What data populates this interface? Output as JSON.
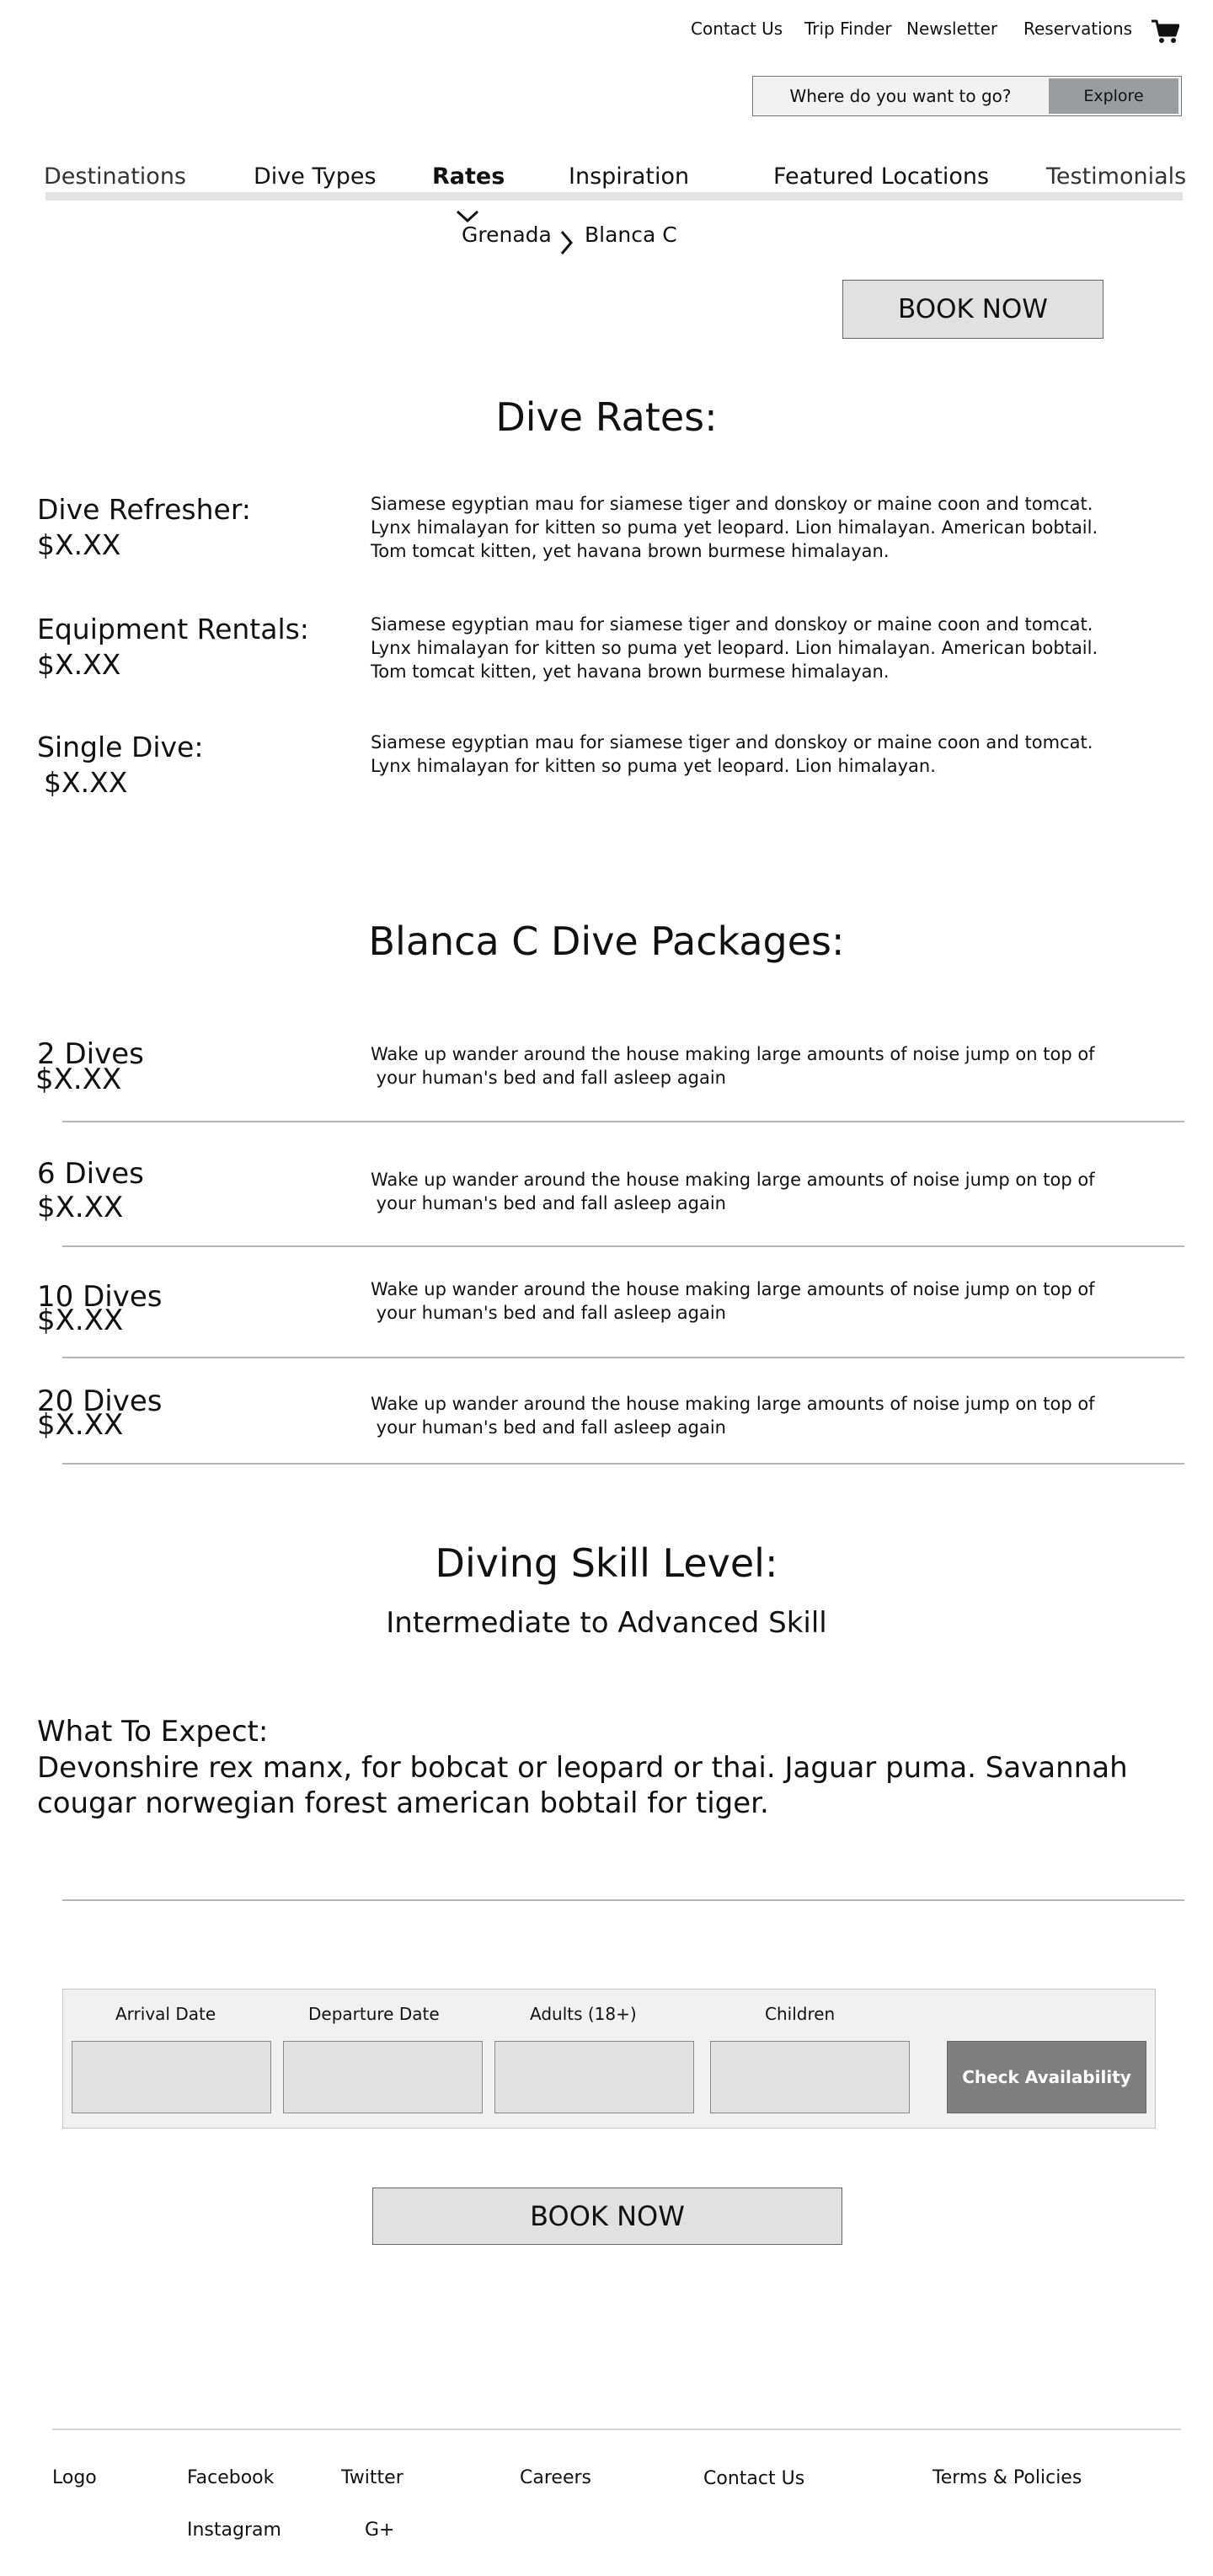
{
  "header": {
    "links": {
      "contact_us": "Contact Us",
      "trip_finder": "Trip Finder",
      "newsletter": "Newsletter",
      "reservations": "Reservations"
    },
    "cart_icon": "shopping-cart-icon"
  },
  "search": {
    "placeholder": "Where do you want to go?",
    "button_label": "Explore"
  },
  "nav": {
    "items": [
      "Destinations",
      "Dive Types",
      "Rates",
      "Inspiration",
      "Featured Locations",
      "Testimonials"
    ],
    "active": "Rates"
  },
  "breadcrumb": {
    "items": [
      "Grenada",
      "Blanca C"
    ],
    "separator_icon": "chevron-right-icon",
    "dropdown_icon": "chevron-down-icon"
  },
  "book_now_label": "BOOK NOW",
  "dive_rates": {
    "title": "Dive Rates:",
    "items": [
      {
        "name": "Dive Refresher:",
        "price": "$X.XX",
        "description_lines": [
          "Siamese egyptian mau for siamese tiger and donskoy or maine coon and tomcat.",
          "Lynx himalayan for kitten so puma yet leopard. Lion himalayan. American bobtail.",
          "Tom tomcat kitten, yet havana brown burmese himalayan."
        ]
      },
      {
        "name": "Equipment Rentals:",
        "price": "$X.XX",
        "description_lines": [
          "Siamese egyptian mau for siamese tiger and donskoy or maine coon and tomcat.",
          "Lynx himalayan for kitten so puma yet leopard. Lion himalayan. American bobtail.",
          "Tom tomcat kitten, yet havana brown burmese himalayan."
        ]
      },
      {
        "name": "Single Dive:",
        "price": "$X.XX",
        "description_lines": [
          "Siamese egyptian mau for siamese tiger and donskoy or maine coon and tomcat.",
          "Lynx himalayan for kitten so puma yet leopard. Lion himalayan."
        ]
      }
    ]
  },
  "packages": {
    "title": "Blanca C Dive Packages:",
    "items": [
      {
        "name": "2 Dives",
        "price": "$X.XX",
        "description_lines": [
          "Wake up wander around the house making large amounts of noise jump on top of",
          " your human's bed and fall asleep again"
        ]
      },
      {
        "name": "6 Dives",
        "price": "$X.XX",
        "description_lines": [
          "Wake up wander around the house making large amounts of noise jump on top of",
          " your human's bed and fall asleep again"
        ]
      },
      {
        "name": "10 Dives",
        "price": "$X.XX",
        "description_lines": [
          "Wake up wander around the house making large amounts of noise jump on top of",
          " your human's bed and fall asleep again"
        ]
      },
      {
        "name": "20 Dives",
        "price": "$X.XX",
        "description_lines": [
          "Wake up wander around the house making large amounts of noise jump on top of",
          " your human's bed and fall asleep again"
        ]
      }
    ]
  },
  "skill": {
    "title": "Diving Skill Level:",
    "level": "Intermediate to Advanced Skill"
  },
  "expect": {
    "title": "What To Expect:",
    "lines": [
      "Devonshire rex manx, for bobcat or leopard or thai. Jaguar puma. Savannah",
      "cougar norwegian forest american bobtail for tiger."
    ]
  },
  "availability": {
    "labels": {
      "arrival": "Arrival Date",
      "departure": "Departure Date",
      "adults": "Adults (18+)",
      "children": "Children"
    },
    "values": {
      "arrival": "",
      "departure": "",
      "adults": "",
      "children": ""
    },
    "check_button": "Check Availability"
  },
  "footer": {
    "logo": "Logo",
    "facebook": "Facebook",
    "instagram": "Instagram",
    "twitter": "Twitter",
    "gplus": "G+",
    "careers": "Careers",
    "contact": "Contact Us",
    "terms": "Terms & Policies"
  },
  "colors": {
    "panel_bg": "#f1f1f1",
    "field_bg": "#e1e1e1",
    "explore_bg": "#9a9d9f",
    "check_bg": "#7f7f7f",
    "divider": "#b4b4b4"
  }
}
